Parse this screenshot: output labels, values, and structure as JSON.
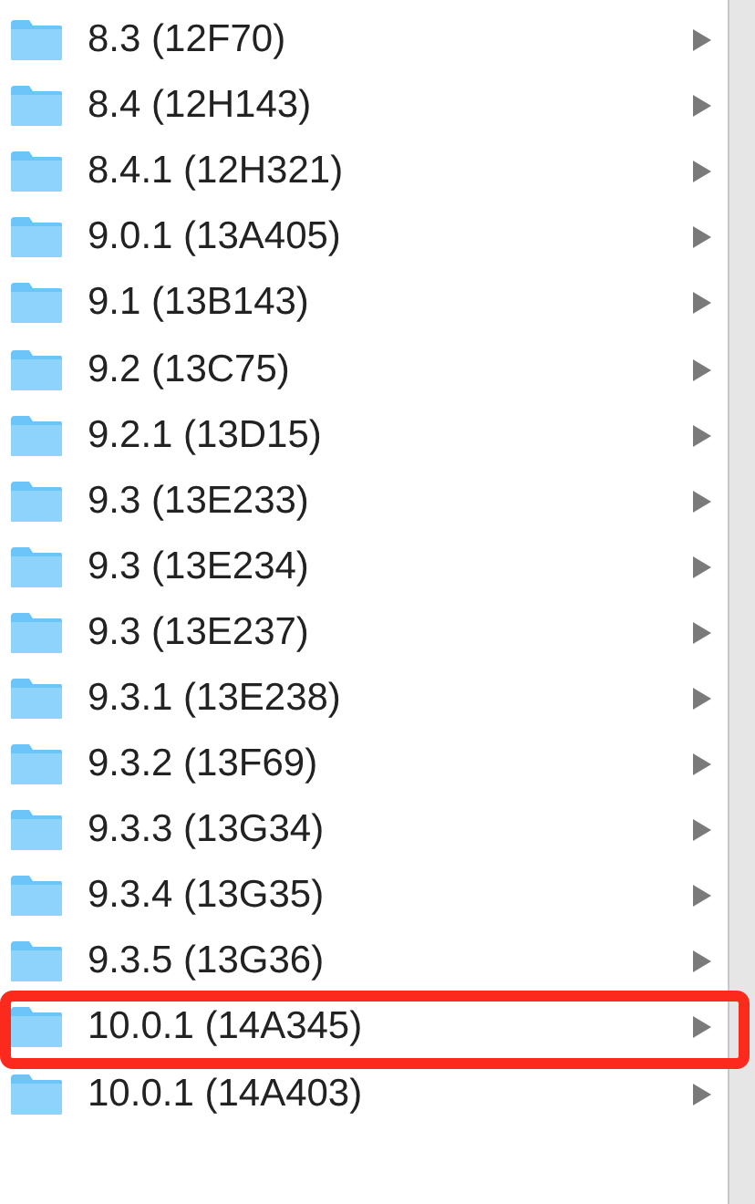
{
  "list": {
    "items": [
      {
        "label": "8.3 (12F70)",
        "highlighted": false
      },
      {
        "label": "8.4 (12H143)",
        "highlighted": false
      },
      {
        "label": "8.4.1 (12H321)",
        "highlighted": false
      },
      {
        "label": "9.0.1 (13A405)",
        "highlighted": false
      },
      {
        "label": "9.1 (13B143)",
        "highlighted": false
      },
      {
        "label": "9.2 (13C75)",
        "highlighted": false
      },
      {
        "label": "9.2.1 (13D15)",
        "highlighted": false
      },
      {
        "label": "9.3 (13E233)",
        "highlighted": false
      },
      {
        "label": "9.3 (13E234)",
        "highlighted": false
      },
      {
        "label": "9.3 (13E237)",
        "highlighted": false
      },
      {
        "label": "9.3.1 (13E238)",
        "highlighted": false
      },
      {
        "label": "9.3.2 (13F69)",
        "highlighted": false
      },
      {
        "label": "9.3.3 (13G34)",
        "highlighted": false
      },
      {
        "label": "9.3.4 (13G35)",
        "highlighted": false
      },
      {
        "label": "9.3.5 (13G36)",
        "highlighted": false
      },
      {
        "label": "10.0.1 (14A345)",
        "highlighted": true
      },
      {
        "label": "10.0.1 (14A403)",
        "highlighted": false
      }
    ]
  }
}
